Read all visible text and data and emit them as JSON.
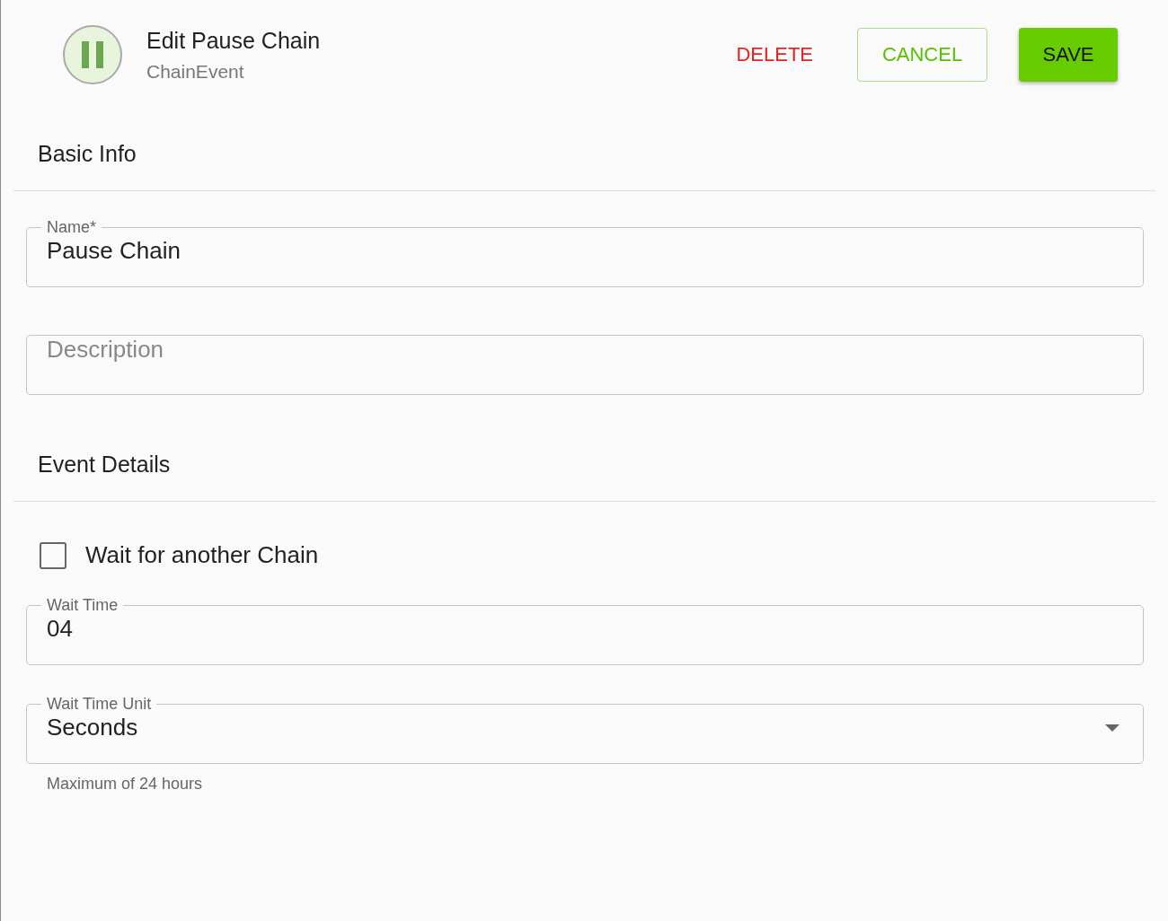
{
  "header": {
    "title": "Edit Pause Chain",
    "subtitle": "ChainEvent",
    "buttons": [
      {
        "label": "DELETE",
        "kind": "text"
      },
      {
        "label": "CANCEL",
        "kind": "outlined"
      },
      {
        "label": "SAVE",
        "kind": "contained"
      }
    ]
  },
  "sections": [
    {
      "title": "Basic Info",
      "items": [
        {
          "kind": "field",
          "label": "Name*",
          "value": "Pause Chain"
        },
        {
          "kind": "field",
          "placeholder": "Description"
        }
      ]
    },
    {
      "title": "Event Details",
      "items": [
        {
          "kind": "checkbox",
          "label": "Wait for another Chain",
          "checked": false
        },
        {
          "kind": "field",
          "label": "Wait Time",
          "value": "04"
        },
        {
          "kind": "select",
          "label": "Wait Time Unit",
          "value": "Seconds",
          "helper": "Maximum of 24 hours"
        }
      ]
    }
  ]
}
